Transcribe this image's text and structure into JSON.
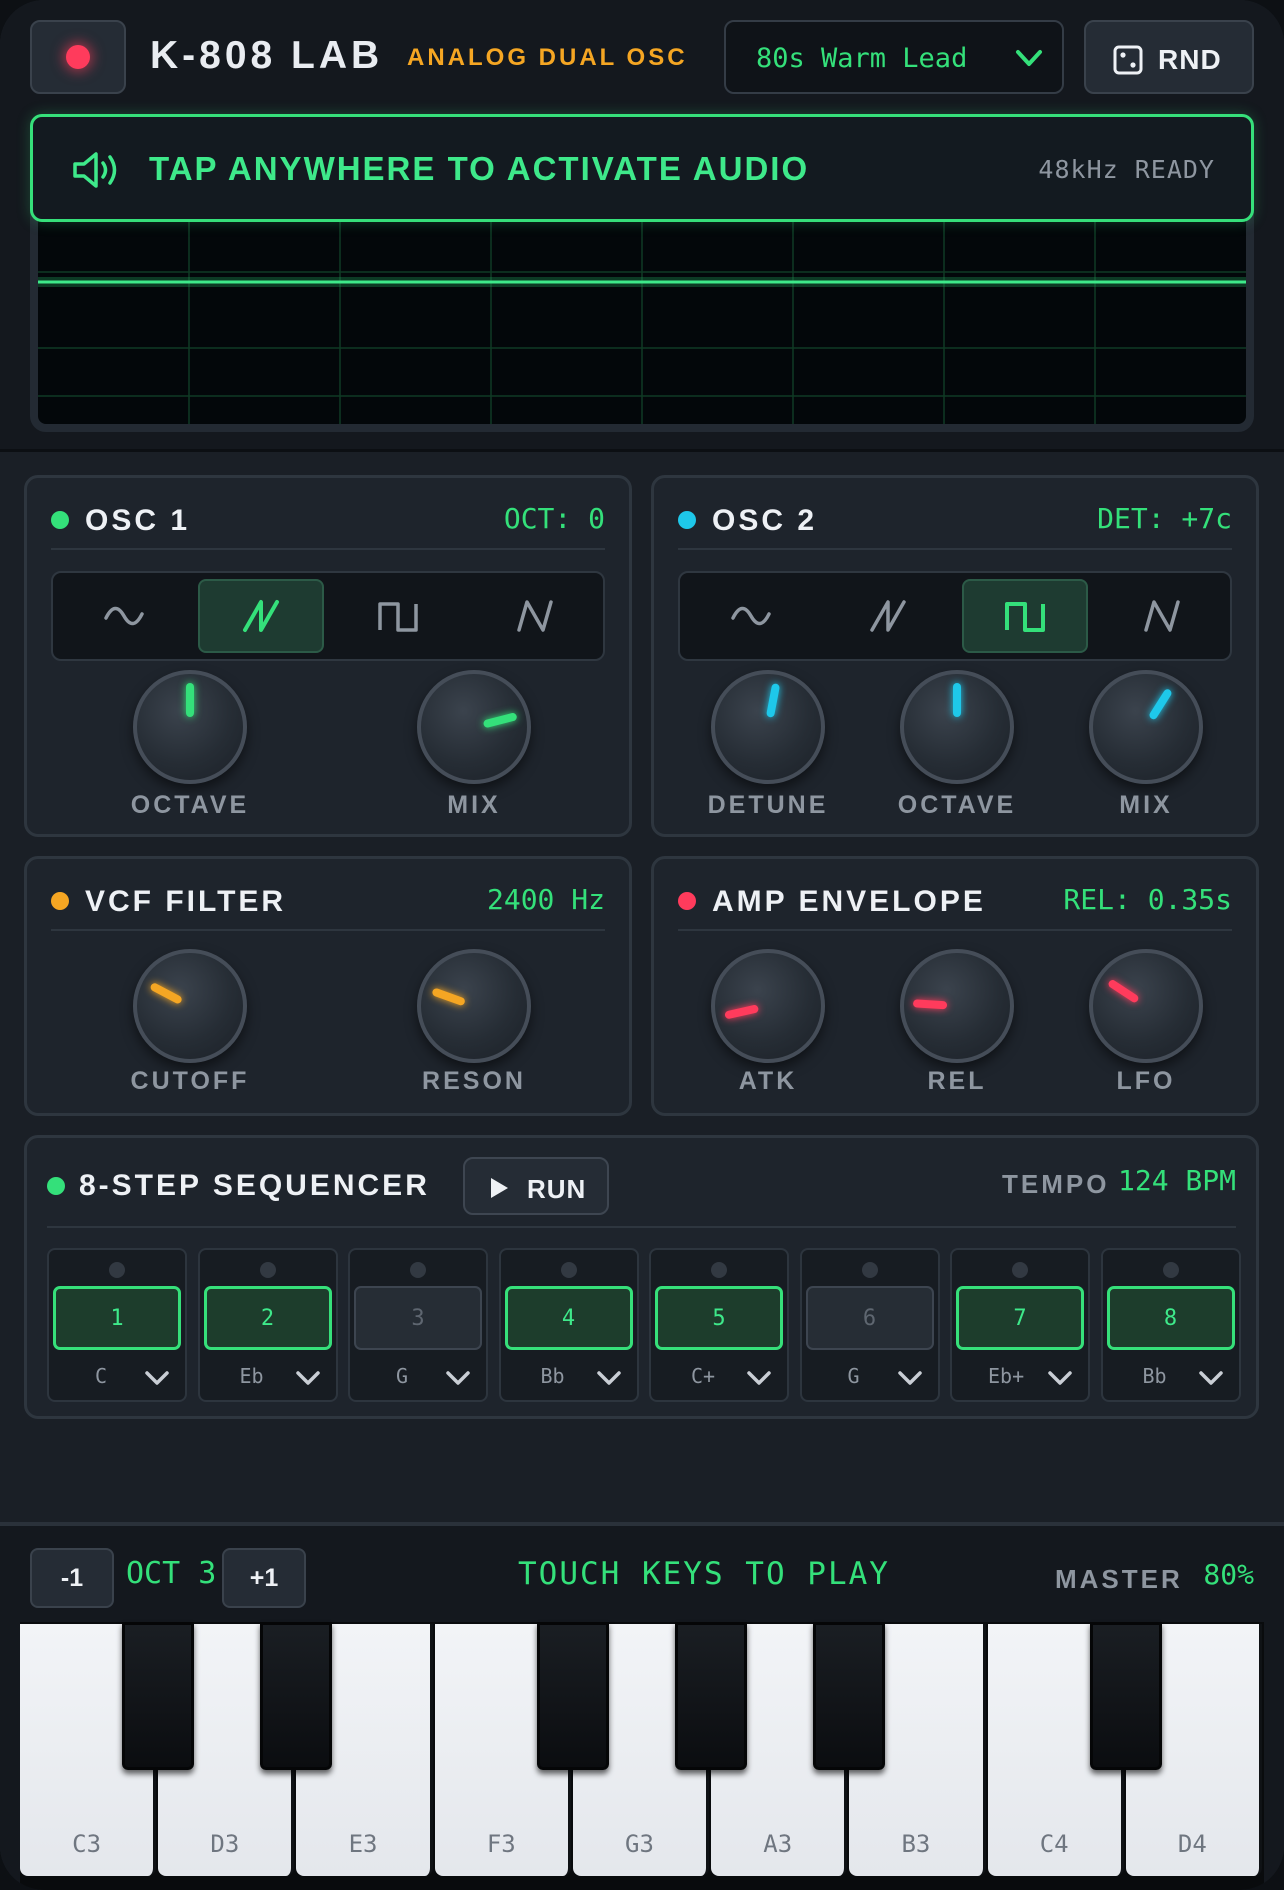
{
  "header": {
    "title": "K-808 LAB",
    "subtitle": "ANALOG DUAL OSC",
    "preset": "80s Warm Lead",
    "rnd_label": "RND"
  },
  "banner": {
    "text": "TAP ANYWHERE TO ACTIVATE AUDIO",
    "status": "48kHz READY"
  },
  "osc1": {
    "title": "OSC 1",
    "readout": "OCT: 0",
    "dot_color": "#34e07a",
    "selected_wave": "saw",
    "knobs": [
      {
        "label": "OCTAVE",
        "value": 0.5,
        "color": "#34e07a"
      },
      {
        "label": "MIX",
        "value": 0.78,
        "color": "#34e07a"
      }
    ]
  },
  "osc2": {
    "title": "OSC 2",
    "readout": "DET: +7c",
    "dot_color": "#1ec8ea",
    "selected_wave": "square",
    "knobs": [
      {
        "label": "DETUNE",
        "value": 0.54,
        "color": "#1ec8ea"
      },
      {
        "label": "OCTAVE",
        "value": 0.5,
        "color": "#1ec8ea"
      },
      {
        "label": "MIX",
        "value": 0.62,
        "color": "#1ec8ea"
      }
    ]
  },
  "vcf": {
    "title": "VCF FILTER",
    "readout": "2400 Hz",
    "dot_color": "#f5a623",
    "knobs": [
      {
        "label": "CUTOFF",
        "value": 0.27,
        "color": "#f5a623"
      },
      {
        "label": "RESON",
        "value": 0.24,
        "color": "#f5a623"
      }
    ]
  },
  "amp": {
    "title": "AMP ENVELOPE",
    "readout": "REL: 0.35s",
    "dot_color": "#ff3b5c",
    "knobs": [
      {
        "label": "ATK",
        "value": 0.12,
        "color": "#ff3b5c"
      },
      {
        "label": "REL",
        "value": 0.18,
        "color": "#ff3b5c"
      },
      {
        "label": "LFO",
        "value": 0.29,
        "color": "#ff3b5c"
      }
    ]
  },
  "waveforms": [
    "sine",
    "saw",
    "square",
    "triangle"
  ],
  "sequencer": {
    "title": "8-STEP SEQUENCER",
    "run_label": "RUN",
    "tempo_label": "TEMPO",
    "tempo_value": "124 BPM",
    "steps": [
      {
        "num": "1",
        "note": "C",
        "on": true
      },
      {
        "num": "2",
        "note": "Eb",
        "on": true
      },
      {
        "num": "3",
        "note": "G",
        "on": false
      },
      {
        "num": "4",
        "note": "Bb",
        "on": true
      },
      {
        "num": "5",
        "note": "C+",
        "on": true
      },
      {
        "num": "6",
        "note": "G",
        "on": false
      },
      {
        "num": "7",
        "note": "Eb+",
        "on": true
      },
      {
        "num": "8",
        "note": "Bb",
        "on": true
      }
    ]
  },
  "keyboard": {
    "oct_down": "-1",
    "oct_label": "OCT 3",
    "oct_up": "+1",
    "touch_label": "TOUCH KEYS TO PLAY",
    "master_label": "MASTER",
    "master_value": "80%",
    "white_keys": [
      "C3",
      "D3",
      "E3",
      "F3",
      "G3",
      "A3",
      "B3",
      "C4",
      "D4"
    ]
  },
  "colors": {
    "accent": "#34e07a",
    "cyan": "#1ec8ea",
    "orange": "#f5a623",
    "red": "#ff3b5c"
  }
}
